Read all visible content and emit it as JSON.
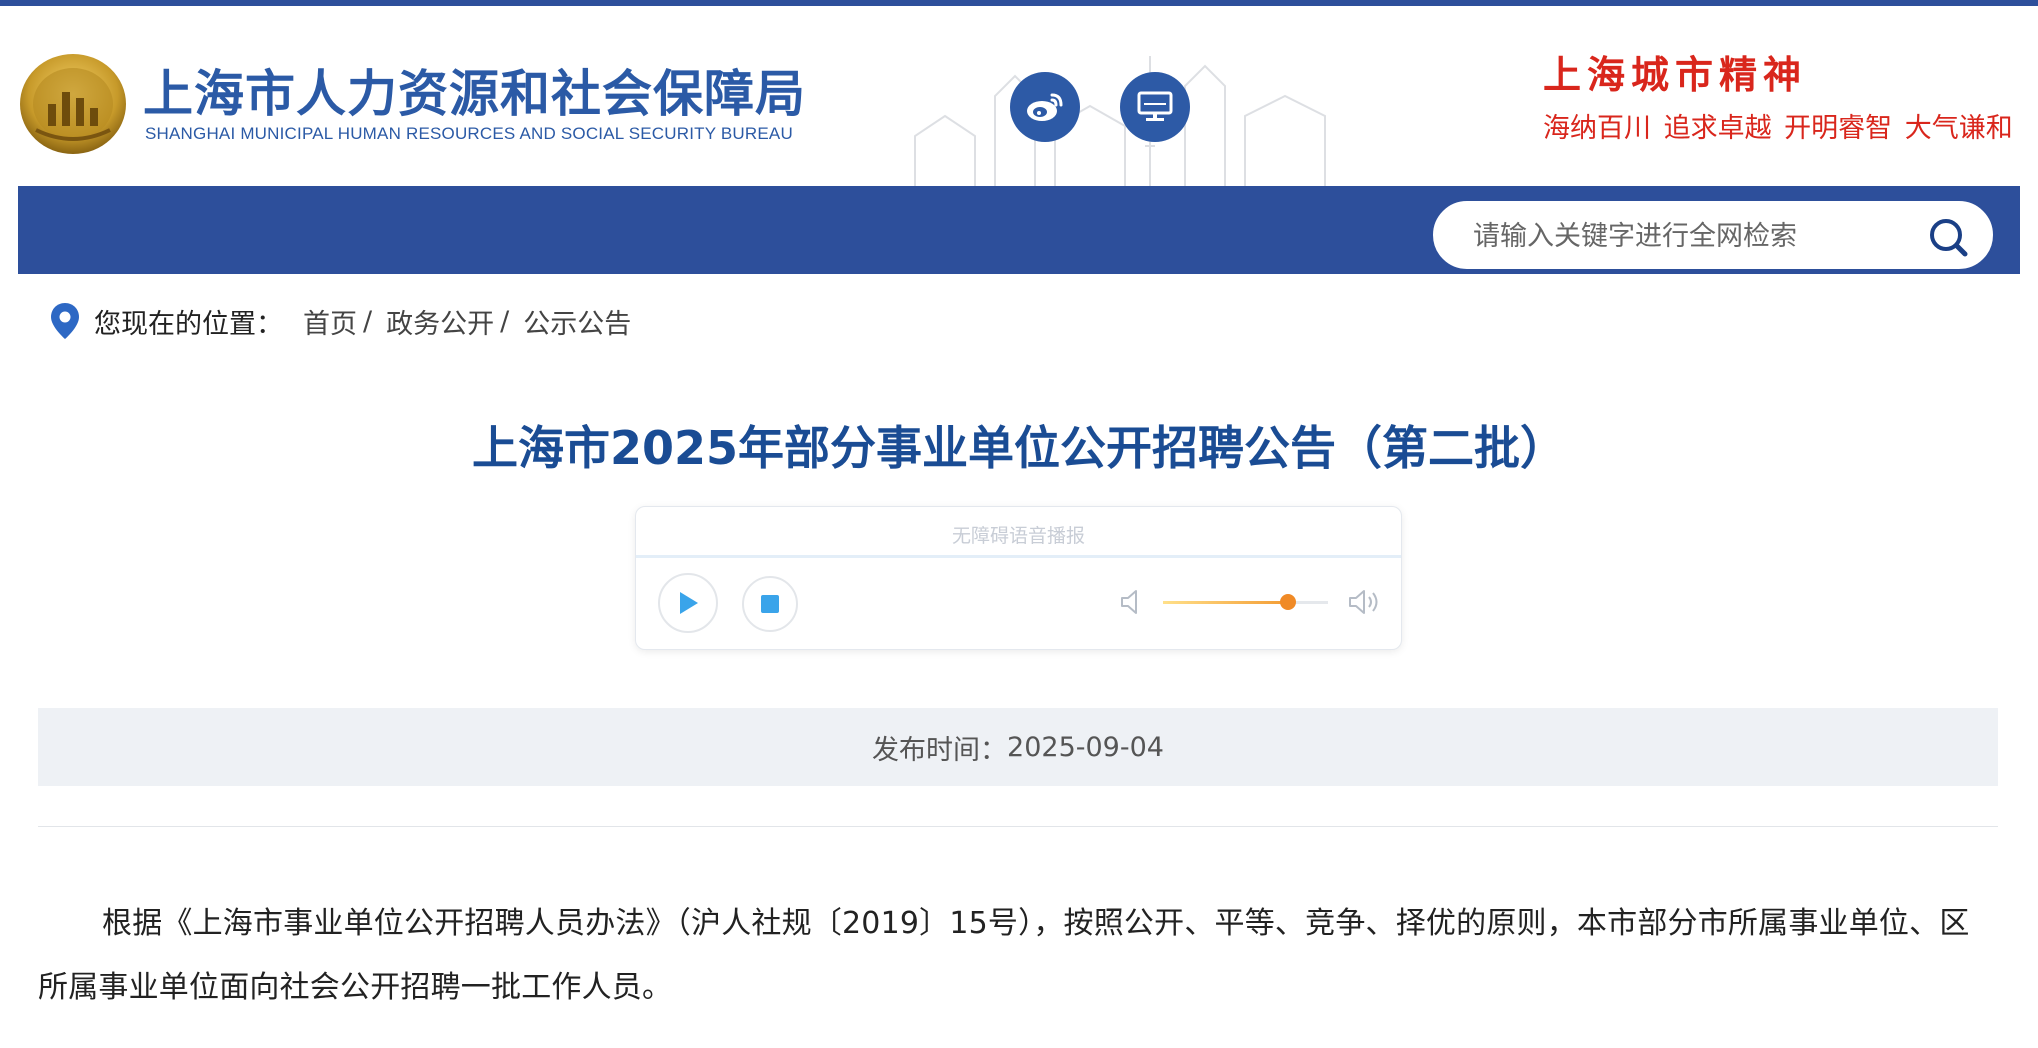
{
  "header": {
    "site_name_cn": "上海市人力资源和社会保障局",
    "site_name_en": "SHANGHAI MUNICIPAL HUMAN RESOURCES AND SOCIAL SECURITY BUREAU",
    "spirit_title": "上海城市精神",
    "spirit_words": "海纳百川  追求卓越  开明睿智  大气谦和",
    "social": [
      {
        "name": "weibo",
        "icon": "weibo-icon"
      },
      {
        "name": "pc",
        "icon": "monitor-icon"
      }
    ]
  },
  "search": {
    "placeholder": "请输入关键字进行全网检索",
    "icon": "search-icon"
  },
  "breadcrumb": {
    "prefix": "您现在的位置：",
    "items": [
      "首页",
      "政务公开",
      "公示公告"
    ],
    "separator": "/"
  },
  "article": {
    "title": "上海市2025年部分事业单位公开招聘公告（第二批）",
    "publish_label": "发布时间：",
    "publish_date": "2025-09-04",
    "paragraph": "根据《上海市事业单位公开招聘人员办法》（沪人社规〔2019〕15号），按照公开、平等、竞争、择优的原则，本市部分市所属事业单位、区所属事业单位面向社会公开招聘一批工作人员。"
  },
  "player": {
    "label": "无障碍语音播报",
    "volume": 0.76
  },
  "colors": {
    "brand_blue": "#2d4f9b",
    "title_blue": "#1a4c94",
    "spirit_red": "#d9261c",
    "volume_orange": "#f08a26"
  }
}
